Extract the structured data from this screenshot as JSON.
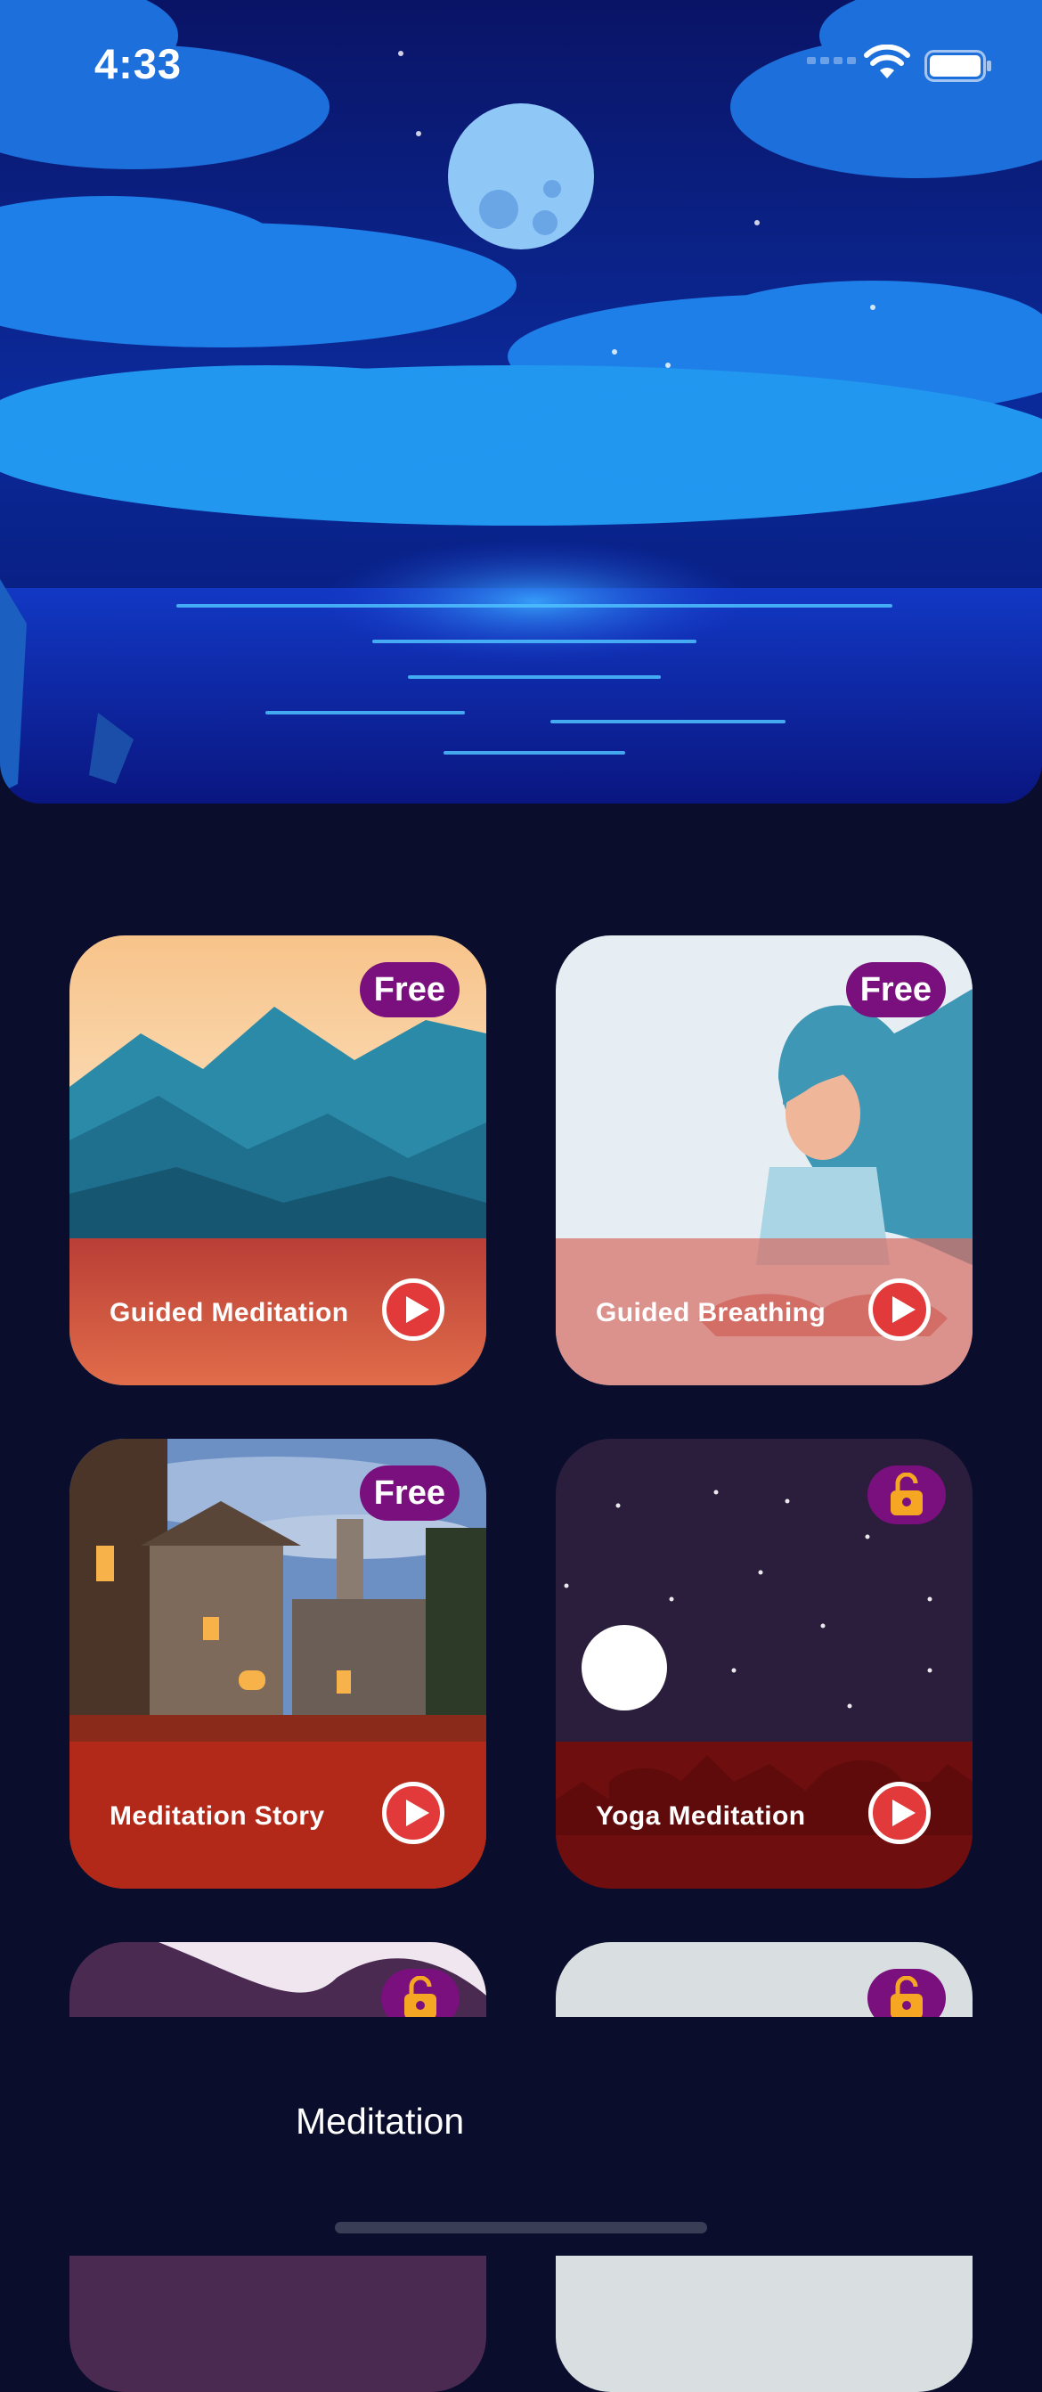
{
  "status_bar": {
    "time": "4:33"
  },
  "cards": [
    {
      "title": "Guided Meditation",
      "badge": "Free",
      "locked": false
    },
    {
      "title": "Guided Breathing",
      "badge": "Free",
      "locked": false
    },
    {
      "title": "Meditation Story",
      "badge": "Free",
      "locked": false
    },
    {
      "title": "Yoga Meditation",
      "badge": null,
      "locked": true
    }
  ],
  "tab_bar": {
    "items": [
      {
        "icon": "flower-icon",
        "label": ""
      },
      {
        "icon": "mountain-sun-icon",
        "label": "Meditation",
        "active": true
      },
      {
        "icon": "flame-icon",
        "label": ""
      },
      {
        "icon": "sliders-icon",
        "label": ""
      }
    ]
  },
  "colors": {
    "background": "#0a0d2c",
    "badge": "#7a0f7e",
    "play": "#e23a3a"
  }
}
